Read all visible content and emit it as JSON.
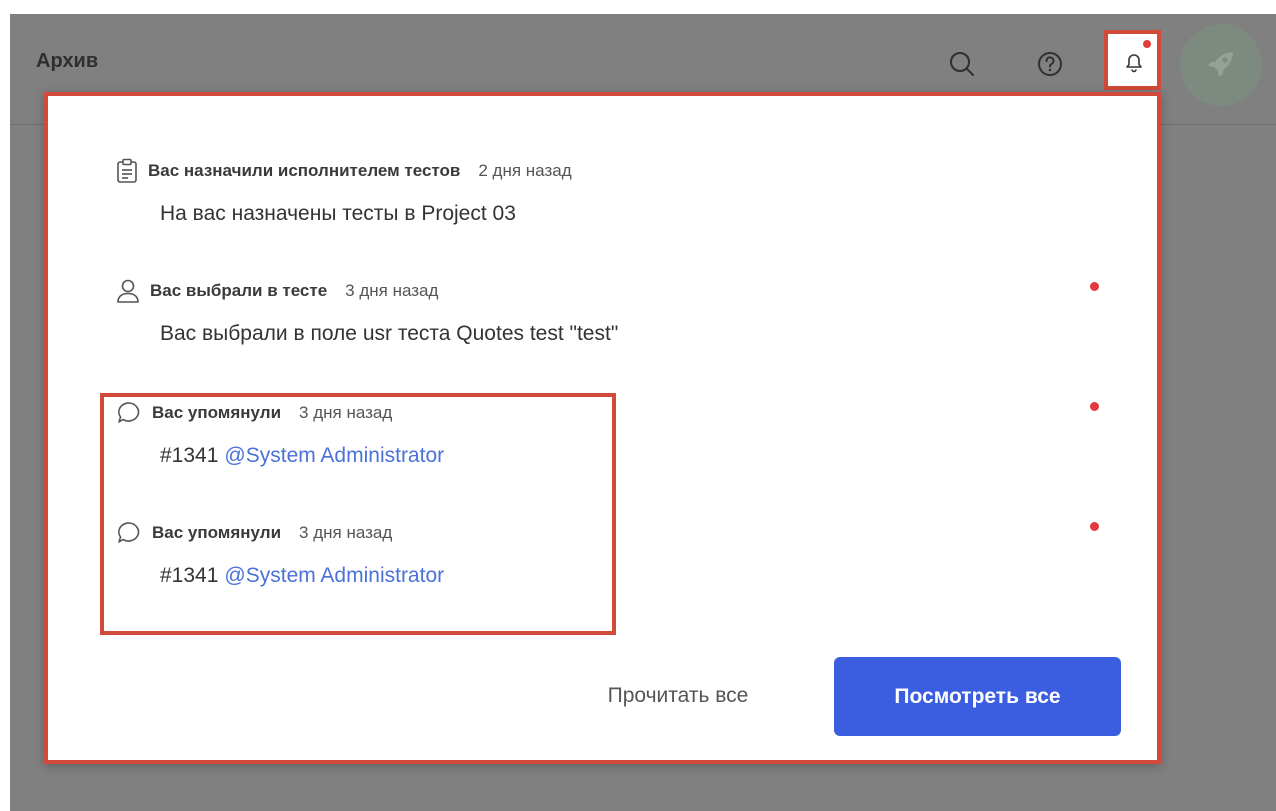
{
  "header": {
    "page_title": "Архив",
    "icons": [
      "search-icon",
      "help-icon",
      "bell-icon",
      "rocket-icon"
    ]
  },
  "notifications": [
    {
      "icon": "clipboard-icon",
      "type": "Вас назначили исполнителем тестов",
      "time": "2 дня назад",
      "body": "На вас назначены тесты в Project 03",
      "unread": false
    },
    {
      "icon": "user-icon",
      "type": "Вас выбрали в тесте",
      "time": "3 дня назад",
      "body": "Вас выбрали в поле usr теста Quotes test \"test\"",
      "unread": true
    },
    {
      "icon": "comment-icon",
      "type": "Вас упомянули",
      "time": "3 дня назад",
      "body_prefix": "#1341",
      "mention": "@System Administrator",
      "unread": true
    },
    {
      "icon": "comment-icon",
      "type": "Вас упомянули",
      "time": "3 дня назад",
      "body_prefix": "#1341",
      "mention": "@System Administrator",
      "unread": true
    }
  ],
  "actions": {
    "read_all": "Прочитать все",
    "view_all": "Посмотреть все"
  },
  "colors": {
    "accent": "#3b5ee0",
    "mention": "#4a72d9",
    "unread_dot": "#e23b3b",
    "highlight": "#d24a3b"
  }
}
